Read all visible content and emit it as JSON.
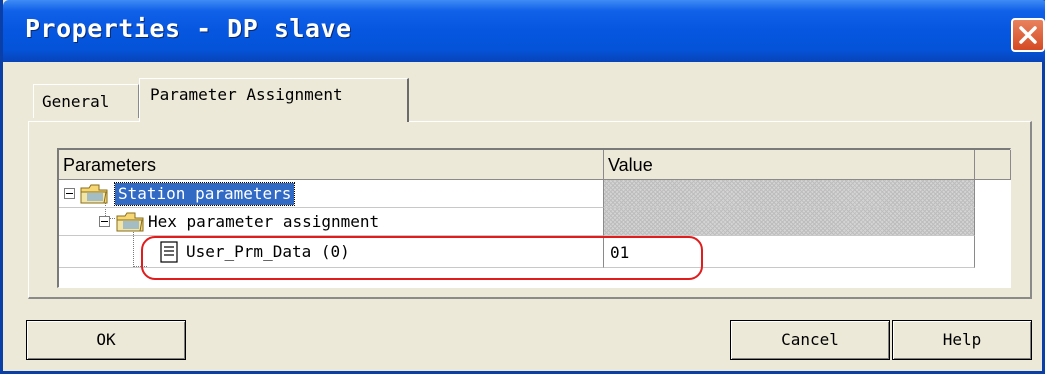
{
  "window": {
    "title": "Properties - DP slave"
  },
  "tabs": [
    {
      "label": "General",
      "active": false
    },
    {
      "label": "Parameter Assignment",
      "active": true
    }
  ],
  "table": {
    "columns": [
      "Parameters",
      "Value"
    ],
    "rows": [
      {
        "label": "Station parameters",
        "value": "",
        "icon": "folder-icon",
        "expanded": true,
        "selected": true
      },
      {
        "label": "Hex parameter assignment",
        "value": "",
        "icon": "folder-icon",
        "expanded": true,
        "selected": false
      },
      {
        "label": "User_Prm_Data (0)",
        "value": "01",
        "icon": "document-icon",
        "selected": false
      }
    ]
  },
  "buttons": {
    "ok": "OK",
    "cancel": "Cancel",
    "help": "Help"
  },
  "colors": {
    "titlebar": "#0656e0",
    "selection": "#316ac5",
    "highlight_ring": "#e01c1c",
    "close_button": "#d44a24"
  }
}
